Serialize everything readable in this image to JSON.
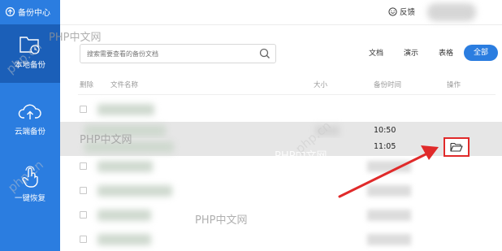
{
  "sidebar": {
    "header": "备份中心",
    "items": [
      {
        "label": "本地备份",
        "icon": "folder-clock-icon"
      },
      {
        "label": "云端备份",
        "icon": "cloud-upload-icon"
      },
      {
        "label": "一键恢复",
        "icon": "hand-pointer-icon"
      }
    ]
  },
  "topbar": {
    "feedback": "反馈"
  },
  "search": {
    "placeholder": "搜索需要查看的备份文档"
  },
  "filters": {
    "doc": "文档",
    "ppt": "演示",
    "xls": "表格",
    "all": "全部"
  },
  "table": {
    "headers": {
      "del": "删除",
      "name": "文件名称",
      "size": "大小",
      "time": "备份时间",
      "op": "操作"
    },
    "visible_times": [
      "10:50",
      "11:05"
    ]
  },
  "watermarks": {
    "text": "PHP中文网",
    "site": "php.cn"
  },
  "colors": {
    "accent": "#2b7de0",
    "sidebar_active": "#1b5fb8",
    "highlight": "#e02a2a"
  }
}
